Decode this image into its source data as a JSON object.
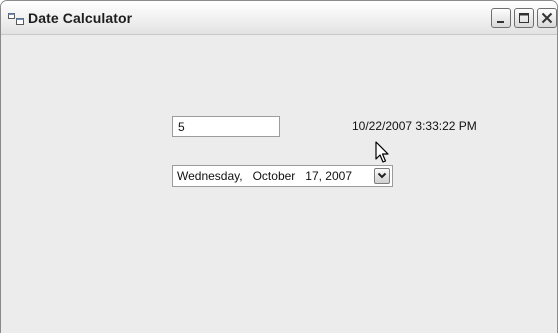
{
  "window": {
    "title": "Date Calculator",
    "controls": {
      "minimize_icon": "minimize-icon",
      "maximize_icon": "maximize-icon",
      "close_icon": "close-icon"
    }
  },
  "form": {
    "days_input": {
      "value": "5"
    },
    "current_datetime": "10/22/2007 3:33:22 PM",
    "date_picker": {
      "value": "Wednesday,   October   17, 2007",
      "dropdown_icon": "chevron-down-icon"
    }
  },
  "colors": {
    "window_background": "#ececec",
    "field_background": "#ffffff",
    "text": "#111111"
  }
}
